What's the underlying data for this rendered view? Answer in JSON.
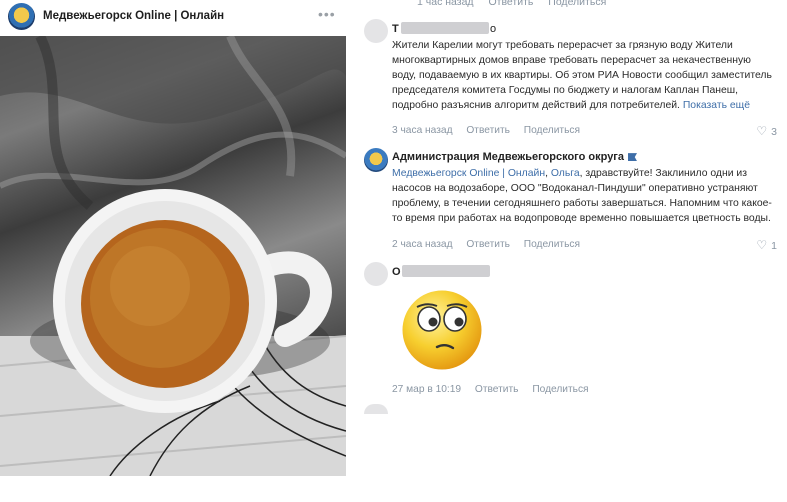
{
  "page": {
    "title": "Медвежьегорск Online | Онлайн"
  },
  "top_actions": {
    "time": "1 час назад",
    "reply": "Ответить",
    "share": "Поделиться"
  },
  "comments": [
    {
      "name_prefix": "Т",
      "name_suffix": "о",
      "text": "Жители Карелии могут требовать перерасчет за грязную воду Жители многоквартирных домов вправе требовать перерасчет за некачественную воду, подаваемую в их квартиры. Об этом РИА Новости сообщил заместитель председателя комитета Госдумы по бюджету и налогам Каплан Панеш, подробно разъяснив алгоритм действий для потребителей.",
      "show_more": "Показать ещё",
      "time": "3 часа назад",
      "reply": "Ответить",
      "share": "Поделиться",
      "likes": "3"
    },
    {
      "name": "Администрация Медвежьегорского округа",
      "mention1": "Медвежьегорск Online | Онлайн",
      "mention2": "Ольга",
      "text": ", здравствуйте! Заклинило одни из насосов на водозаборе, ООО \"Водоканал-Пиндуши\" оперативно устраняют проблему, в течении сегодняшнего работы завершаться. Напомним что какое-то время при работах на водопроводе временно повышается цветность воды.",
      "time": "2 часа назад",
      "reply": "Ответить",
      "share": "Поделиться",
      "likes": "1"
    },
    {
      "name_prefix": "О",
      "time": "27 мар в 10:19",
      "reply": "Ответить",
      "share": "Поделиться"
    }
  ],
  "icons": [
    "more-icon",
    "heart-icon",
    "flag-icon",
    "sticker-emoji"
  ]
}
